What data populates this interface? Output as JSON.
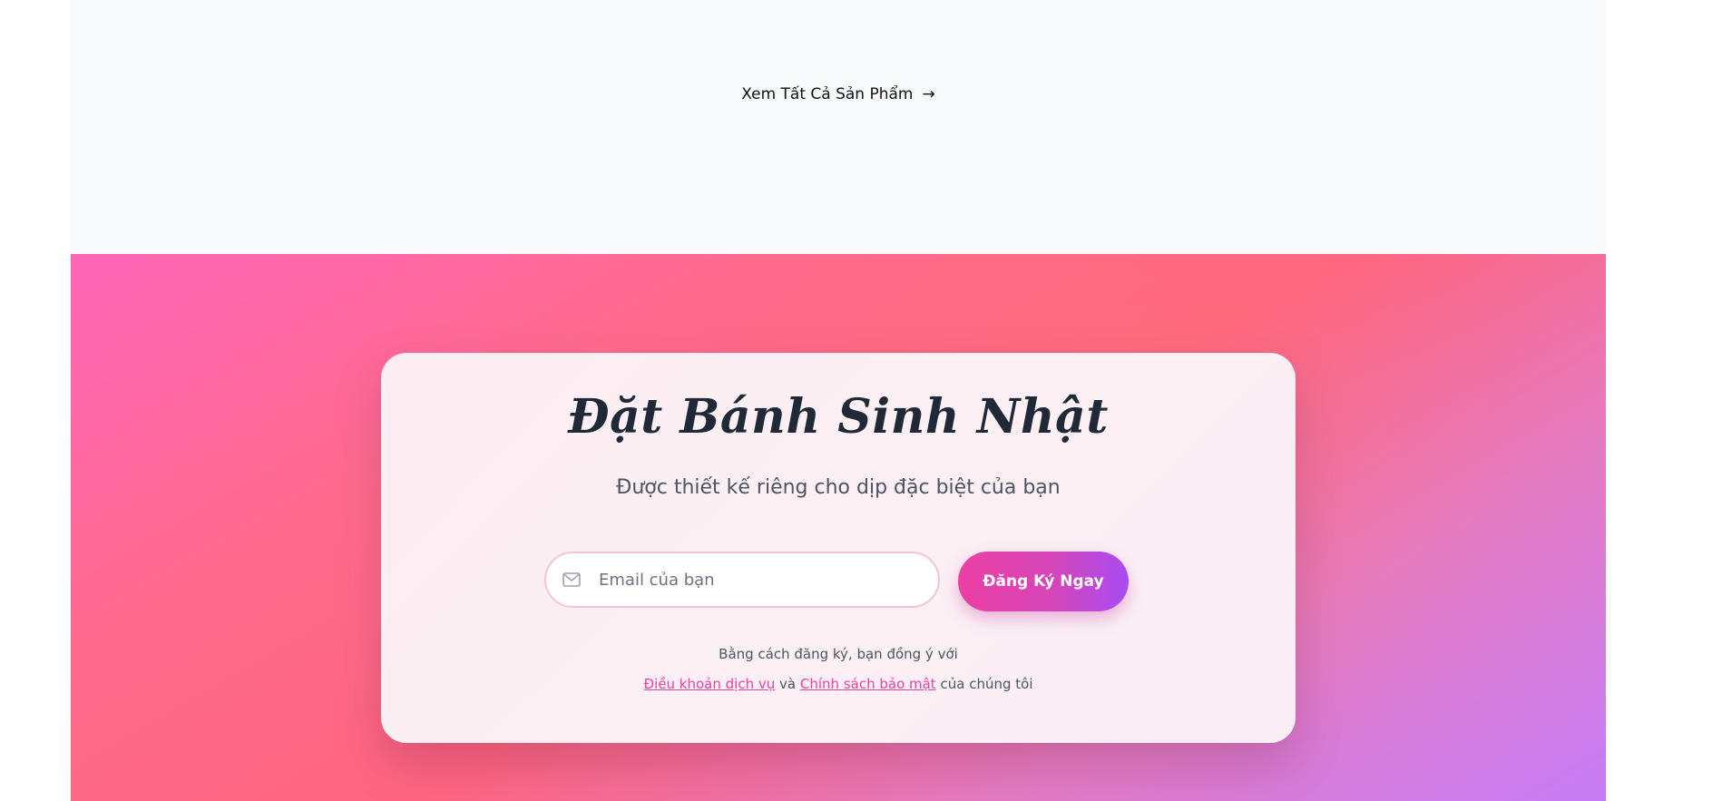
{
  "top_section": {
    "view_all_label": "Xem Tất Cả Sản Phẩm",
    "view_all_arrow": "→"
  },
  "signup": {
    "title": "Đặt Bánh Sinh Nhật",
    "subtitle": "Được thiết kế riêng cho dịp đặc biệt của bạn",
    "email_placeholder": "Email của bạn",
    "email_icon": "mail-icon",
    "submit_label": "Đăng Ký Ngay",
    "terms_intro": "Bằng cách đăng ký, bạn đồng ý với",
    "terms_link": "Điều khoản dịch vụ",
    "terms_and": "và",
    "privacy_link": "Chính sách bảo mật",
    "terms_suffix": "của chúng tôi"
  },
  "colors": {
    "top_background": "#f8f9fb",
    "gradient_pink": "#ff66b8",
    "gradient_coral": "#ff6580",
    "gradient_purple": "#c67cf6",
    "accent_link": "#ec3fa3",
    "button_start": "#ec3fa3",
    "button_end": "#a84cf5",
    "title_text": "#1f2937"
  }
}
